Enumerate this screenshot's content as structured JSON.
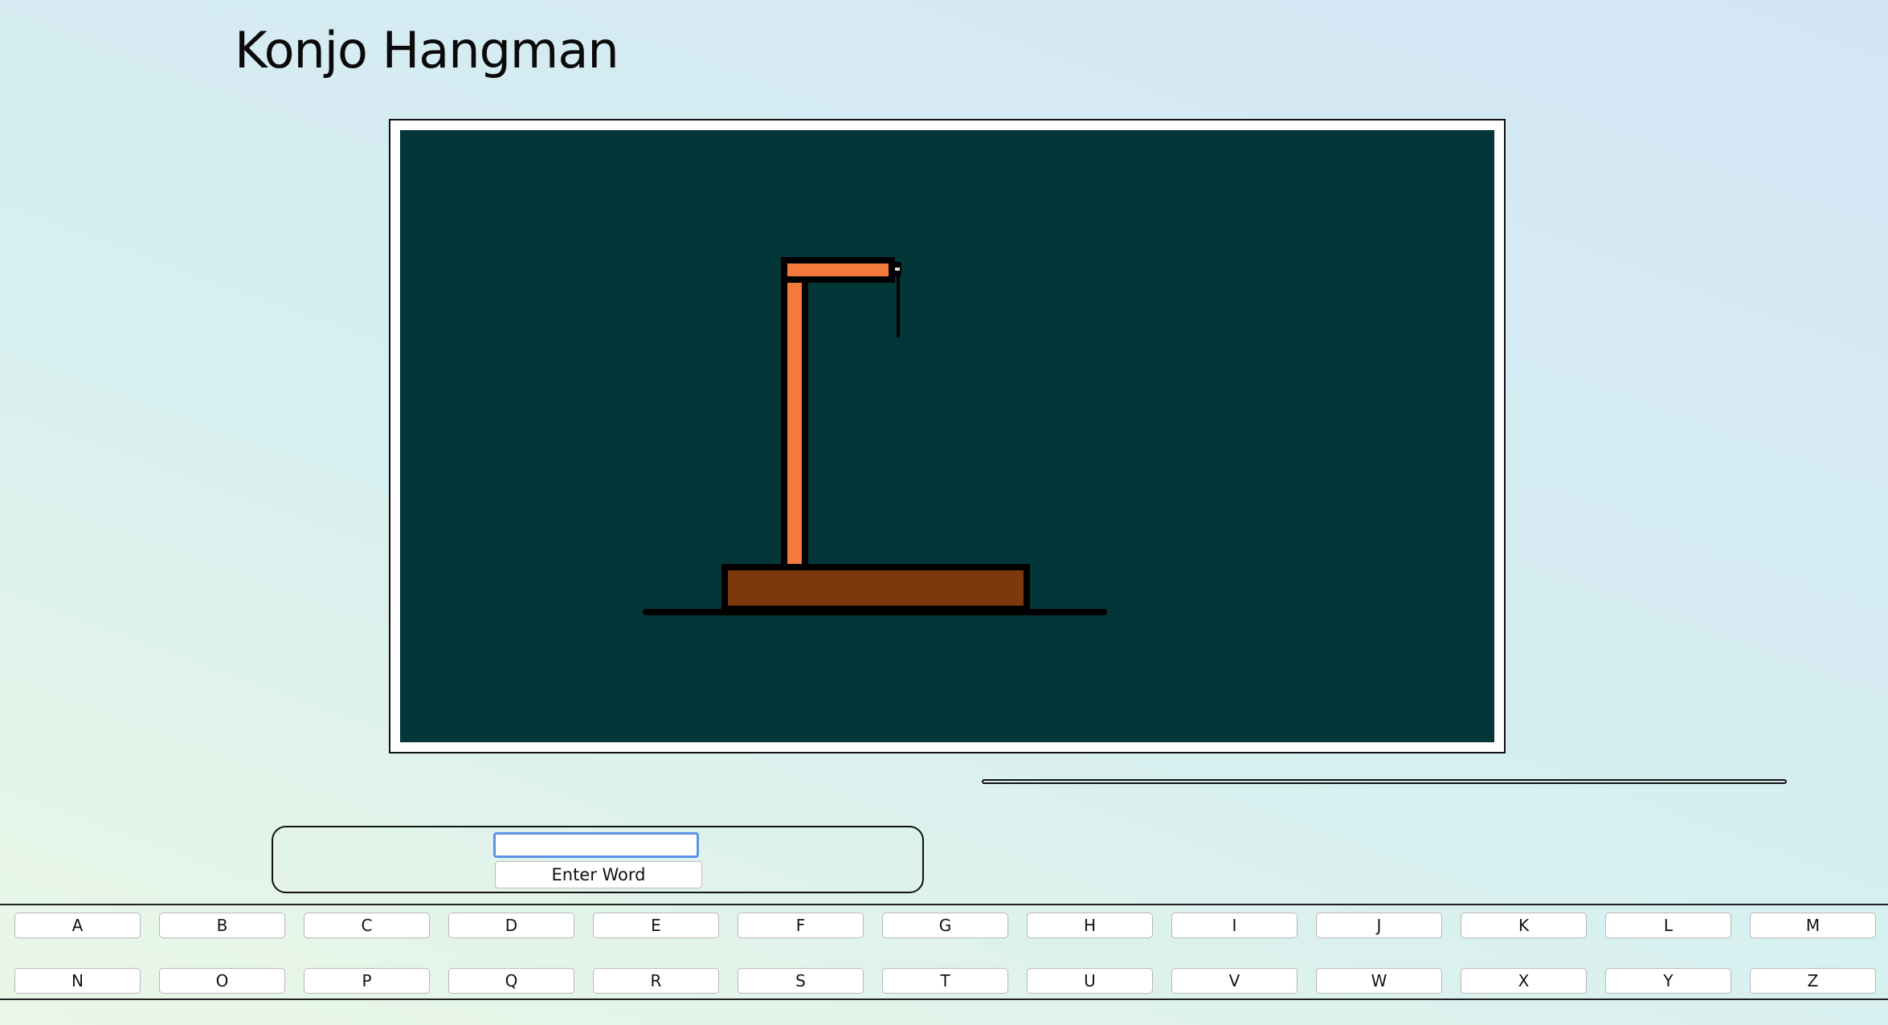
{
  "header": {
    "title": "Konjo Hangman"
  },
  "board": {
    "background_color": "#033638",
    "gallows_color": "#f47a3a",
    "base_color": "#7a3a0c",
    "outline_color": "#000000",
    "wrong_guesses": 0
  },
  "word_entry": {
    "input_value": "",
    "button_label": "Enter Word"
  },
  "keyboard": {
    "row1": [
      "A",
      "B",
      "C",
      "D",
      "E",
      "F",
      "G",
      "H",
      "I",
      "J",
      "K",
      "L",
      "M"
    ],
    "row2": [
      "N",
      "O",
      "P",
      "Q",
      "R",
      "S",
      "T",
      "U",
      "V",
      "W",
      "X",
      "Y",
      "Z"
    ]
  }
}
